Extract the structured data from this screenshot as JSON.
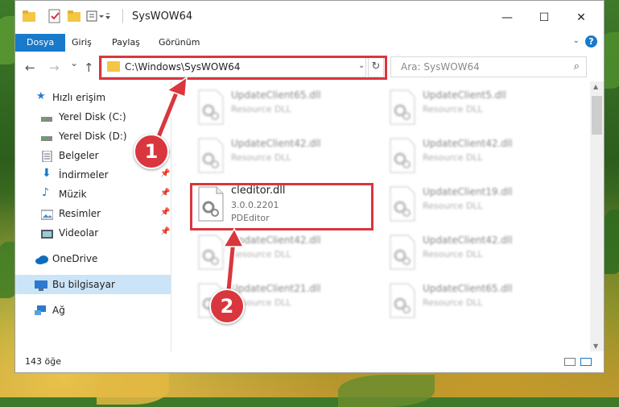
{
  "window": {
    "title": "SysWOW64",
    "controls": {
      "minimize": "—",
      "maximize": "☐",
      "close": "✕"
    }
  },
  "ribbon": {
    "tabs": [
      {
        "label": "Dosya",
        "active": true
      },
      {
        "label": "Giriş"
      },
      {
        "label": "Paylaş"
      },
      {
        "label": "Görünüm"
      }
    ],
    "help": "?"
  },
  "nav": {
    "back": "←",
    "forward": "→",
    "recent": "⌄",
    "up": "↑",
    "address": "C:\\Windows\\SysWOW64",
    "refresh": "↻",
    "search_placeholder": "Ara: SysWOW64",
    "search_icon": "⌕"
  },
  "sidebar": {
    "items": [
      {
        "label": "Hızlı erişim",
        "icon": "star-icon"
      },
      {
        "label": "Yerel Disk (C:)",
        "icon": "drive-icon",
        "pinned": true
      },
      {
        "label": "Yerel Disk (D:)",
        "icon": "drive-icon",
        "pinned": true
      },
      {
        "label": "Belgeler",
        "icon": "document-icon",
        "pinned": true
      },
      {
        "label": "İndirmeler",
        "icon": "download-icon",
        "pinned": true
      },
      {
        "label": "Müzik",
        "icon": "music-icon",
        "pinned": true
      },
      {
        "label": "Resimler",
        "icon": "pictures-icon",
        "pinned": true
      },
      {
        "label": "Videolar",
        "icon": "video-icon",
        "pinned": true
      },
      {
        "label": "OneDrive",
        "icon": "cloud-icon"
      },
      {
        "label": "Bu bilgisayar",
        "icon": "computer-icon",
        "selected": true
      },
      {
        "label": "Ağ",
        "icon": "network-icon"
      }
    ]
  },
  "files": {
    "left_column": [
      {
        "name": "UpdateClient65.dll",
        "sub": "Resource DLL"
      },
      {
        "name": "UpdateClient42.dll",
        "sub": "Resource DLL"
      },
      {
        "name": "cleditor.dll",
        "version": "3.0.0.2201",
        "sub": "PDEditor"
      },
      {
        "name": "UpdateClient42.dll",
        "sub": "Resource DLL"
      },
      {
        "name": "UpdateClient21.dll",
        "sub": "Resource DLL"
      }
    ],
    "right_column": [
      {
        "name": "UpdateClient5.dll",
        "sub": "Resource DLL"
      },
      {
        "name": "UpdateClient42.dll",
        "sub": "Resource DLL"
      },
      {
        "name": "UpdateClient19.dll",
        "sub": "Resource DLL"
      },
      {
        "name": "UpdateClient42.dll",
        "sub": "Resource DLL"
      },
      {
        "name": "UpdateClient65.dll",
        "sub": "Resource DLL"
      }
    ]
  },
  "status": {
    "count": "143 öğe"
  },
  "annotations": {
    "step1": "1",
    "step2": "2"
  },
  "colors": {
    "accent": "#1979ca",
    "highlight": "#d9363e",
    "selected": "#cce4f7"
  }
}
